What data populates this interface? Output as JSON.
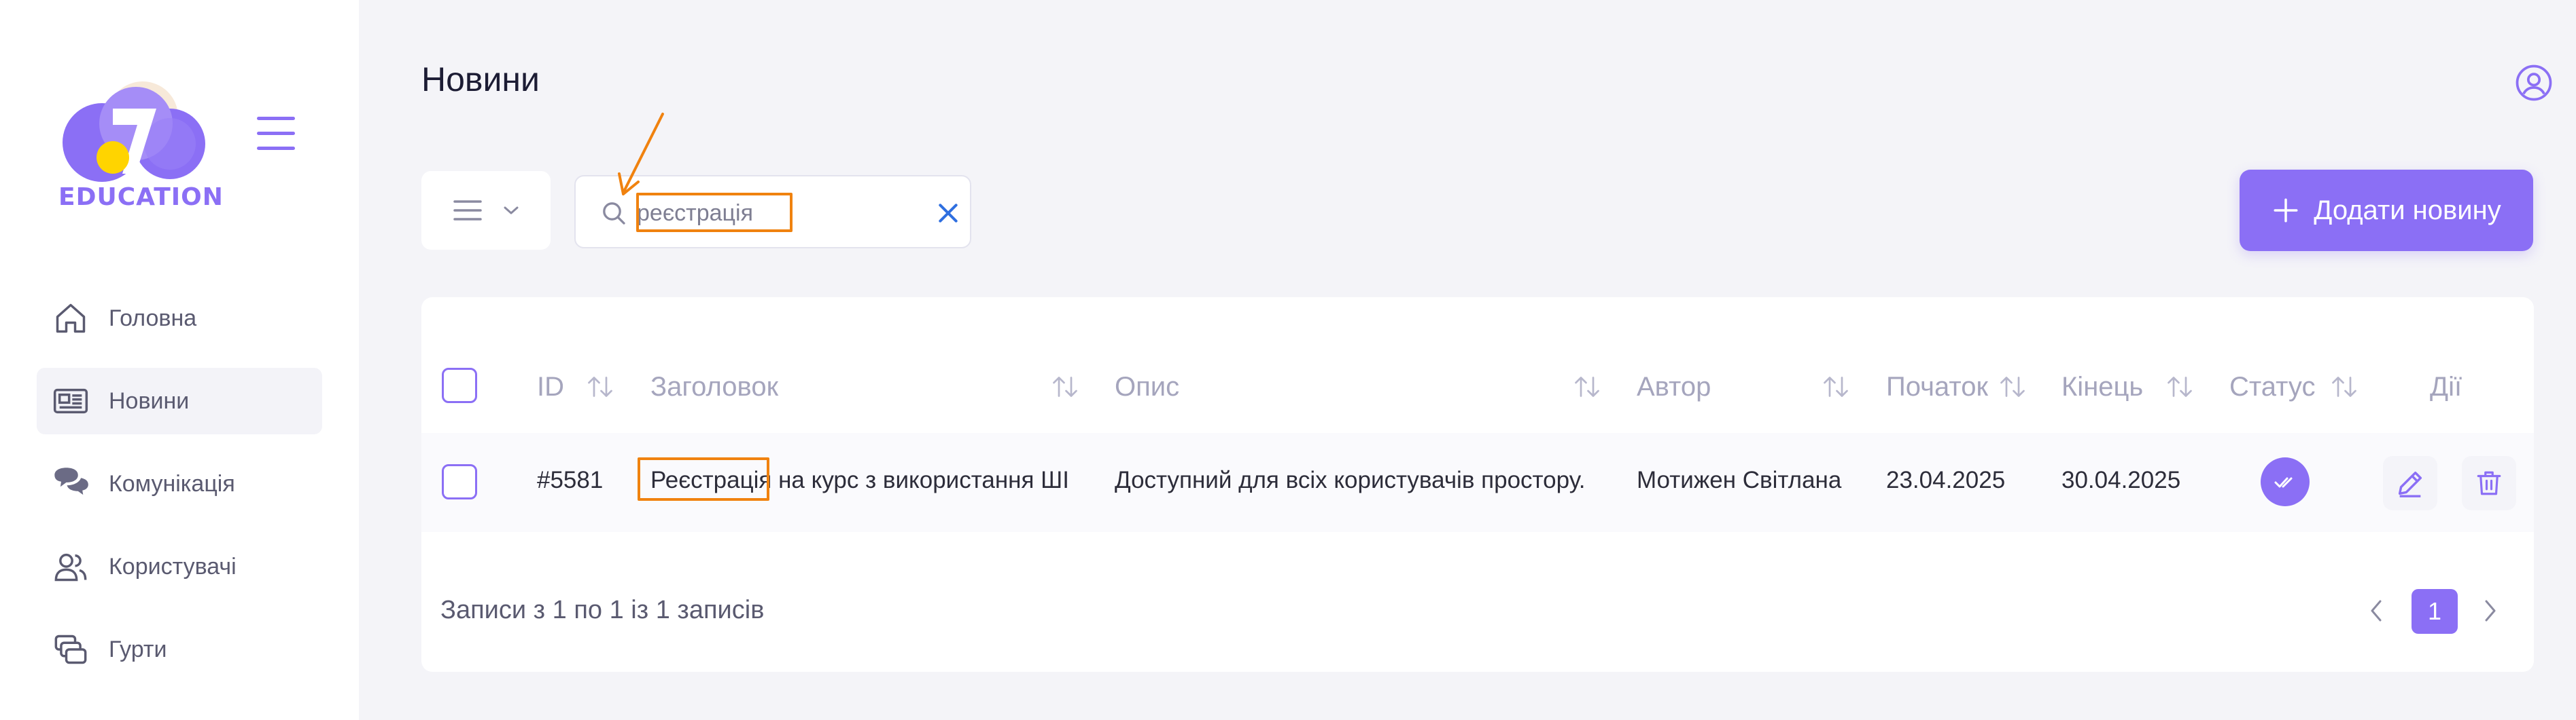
{
  "brand": {
    "logo_text": "EDUCATION",
    "accent": "#8b6ff5",
    "highlight": "#f0820f"
  },
  "sidebar": {
    "items": [
      {
        "label": "Головна",
        "icon": "home-icon"
      },
      {
        "label": "Новини",
        "icon": "newspaper-icon",
        "active": true
      },
      {
        "label": "Комунікація",
        "icon": "chat-bubbles-icon"
      },
      {
        "label": "Користувачі",
        "icon": "users-icon"
      },
      {
        "label": "Гурти",
        "icon": "groups-icon"
      }
    ]
  },
  "header": {
    "title": "Новини"
  },
  "toolbar": {
    "search_value": "реєстрація",
    "search_placeholder": "",
    "add_button_label": "Додати новину"
  },
  "table": {
    "headers": {
      "id": "ID",
      "title": "Заголовок",
      "description": "Опис",
      "author": "Автор",
      "start": "Початок",
      "end": "Кінець",
      "status": "Статус",
      "actions": "Дії"
    },
    "rows": [
      {
        "id": "#5581",
        "title_match": "Реєстрація",
        "title_rest": " на курс з використання ШІ",
        "description": "Доступний для всіх користувачів простору.",
        "author": "Мотижен Світлана",
        "start": "23.04.2025",
        "end": "30.04.2025",
        "status": "published"
      }
    ]
  },
  "footer": {
    "records_text": "Записи з 1 по 1 із 1 записів"
  },
  "pagination": {
    "current": "1"
  }
}
